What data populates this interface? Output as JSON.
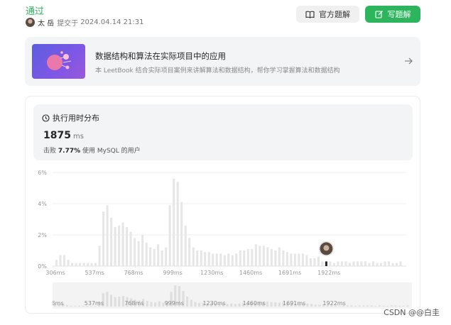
{
  "header": {
    "status": "通过",
    "author": "太 岳",
    "submitted_verb": "提交于",
    "submitted_time": "2024.04.14 21:31",
    "official_solution_label": "官方题解",
    "write_solution_label": "写题解"
  },
  "promo": {
    "title": "数据结构和算法在实际项目中的应用",
    "subtitle": "本 LeetBook 结合实际项目案例来讲解算法和数据结构，帮你学习掌握算法和数据结构"
  },
  "stats": {
    "title": "执行用时分布",
    "value": "1875",
    "unit": "ms",
    "beat_prefix": "击败",
    "beat_percent": "7.77%",
    "beat_suffix": "使用 MySQL 的用户"
  },
  "chart_data": {
    "type": "bar",
    "title": "执行用时分布",
    "xlabel": "",
    "ylabel": "",
    "ylim": [
      0,
      6
    ],
    "yticks": [
      "0%",
      "2%",
      "4%",
      "6%"
    ],
    "xticks": [
      "306ms",
      "537ms",
      "768ms",
      "999ms",
      "1230ms",
      "1460ms",
      "1691ms",
      "1922ms"
    ],
    "x_start_ms": 306,
    "x_step_ms": 23.1,
    "values": [
      0.4,
      0.7,
      0.7,
      0.4,
      0.2,
      0.2,
      0.2,
      0.2,
      0.2,
      0.2,
      0.2,
      1.3,
      3.5,
      3.9,
      3.1,
      2.5,
      2.6,
      2.8,
      2.5,
      2.2,
      1.8,
      1.6,
      2.0,
      1.5,
      1.2,
      1.1,
      1.4,
      1.0,
      1.2,
      3.9,
      5.6,
      5.4,
      4.1,
      2.6,
      1.8,
      1.2,
      1.0,
      1.0,
      0.9,
      0.9,
      0.8,
      0.8,
      0.8,
      0.7,
      0.8,
      0.7,
      0.8,
      1.0,
      1.0,
      1.1,
      1.1,
      1.4,
      1.3,
      1.3,
      1.2,
      1.1,
      1.0,
      1.2,
      1.0,
      0.9,
      0.8,
      0.8,
      0.8,
      0.8,
      0.7,
      0.5,
      0.5,
      0.6,
      0.3,
      0.3,
      0.3,
      0.2,
      0.3,
      0.3,
      0.3,
      0.2,
      0.3,
      0.3,
      0.3,
      0.3,
      0.2,
      0.3,
      0.2,
      0.2,
      0.3,
      0.3,
      0.2,
      0.2,
      0.3
    ],
    "highlight_index": 69,
    "grid": true,
    "bar_color": "#e6e6e6",
    "highlight_color": "#262626"
  },
  "watermark": "CSDN @@白圭"
}
